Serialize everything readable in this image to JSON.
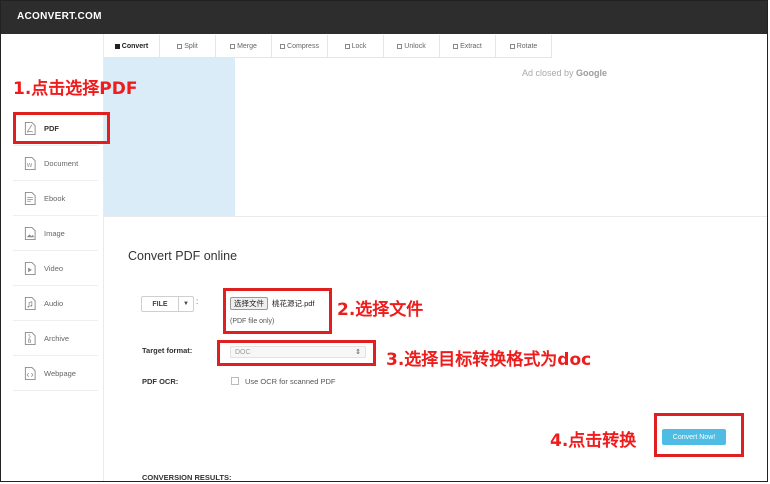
{
  "app": {
    "logo": "ACONVERT.COM"
  },
  "tabs": [
    {
      "label": "Convert",
      "active": true
    },
    {
      "label": "Split"
    },
    {
      "label": "Merge"
    },
    {
      "label": "Compress"
    },
    {
      "label": "Lock"
    },
    {
      "label": "Unlock"
    },
    {
      "label": "Extract"
    },
    {
      "label": "Rotate"
    }
  ],
  "sidebar": {
    "items": [
      {
        "label": "PDF",
        "icon": "pdf-file-icon",
        "active": true
      },
      {
        "label": "Document",
        "icon": "document-icon"
      },
      {
        "label": "Ebook",
        "icon": "ebook-icon"
      },
      {
        "label": "Image",
        "icon": "image-icon"
      },
      {
        "label": "Video",
        "icon": "video-icon"
      },
      {
        "label": "Audio",
        "icon": "audio-icon"
      },
      {
        "label": "Archive",
        "icon": "archive-icon"
      },
      {
        "label": "Webpage",
        "icon": "webpage-icon"
      }
    ]
  },
  "ad": {
    "text": "Ad closed by",
    "brand": "Google"
  },
  "main": {
    "title": "Convert PDF online",
    "file_button": "FILE",
    "colon": ":",
    "choose_file": "选择文件",
    "file_name": "桃花源记.pdf",
    "pdf_only": "(PDF file only)",
    "target_label": "Target format:",
    "target_value": "DOC",
    "ocr_label": "PDF OCR:",
    "ocr_option": "Use OCR for scanned PDF",
    "convert_button": "Convert Now!",
    "results_label": "CONVERSION RESULTS:"
  },
  "annotations": {
    "step1": "1.点击选择PDF",
    "step2": "2.选择文件",
    "step3": "3.选择目标转换格式为doc",
    "step4": "4.点击转换"
  },
  "colors": {
    "accent": "#4fbde3",
    "annotation": "#e02020",
    "topbar": "#2d2d2d",
    "ad_bg": "#d9ecf8"
  }
}
